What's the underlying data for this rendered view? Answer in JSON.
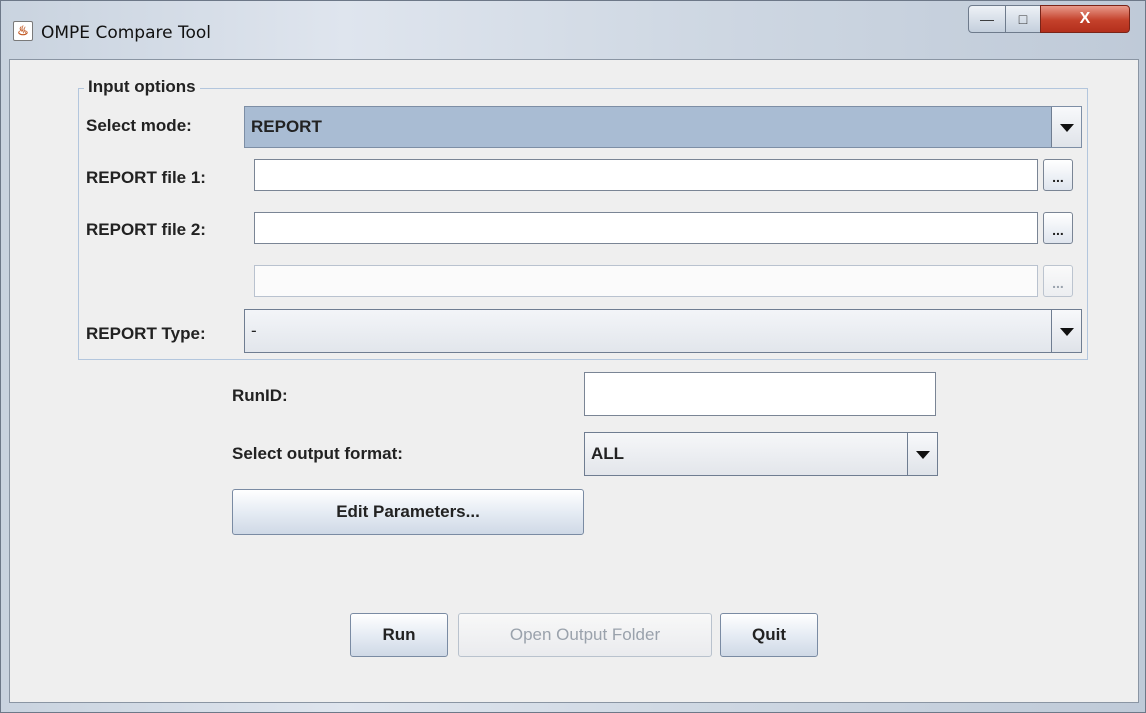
{
  "window": {
    "title": "OMPE Compare Tool",
    "controls": {
      "minimize": "—",
      "maximize": "□",
      "close": "X"
    }
  },
  "input_options": {
    "group_title": "Input options",
    "mode": {
      "label": "Select mode:",
      "value": "REPORT"
    },
    "file1": {
      "label": "REPORT file 1:",
      "value": "",
      "browse": "..."
    },
    "file2": {
      "label": "REPORT file 2:",
      "value": "",
      "browse": "..."
    },
    "file3": {
      "label": "",
      "value": "",
      "browse": "..."
    },
    "report_type": {
      "label": "REPORT Type:",
      "value": "-"
    }
  },
  "run_id": {
    "label": "RunID:",
    "value": ""
  },
  "output_format": {
    "label": "Select output format:",
    "value": "ALL"
  },
  "buttons": {
    "edit_parameters": "Edit Parameters...",
    "run": "Run",
    "open_output_folder": "Open Output Folder",
    "quit": "Quit"
  },
  "colors": {
    "mode_highlight": "#a9bcd3",
    "panel_bg": "#efefef"
  }
}
